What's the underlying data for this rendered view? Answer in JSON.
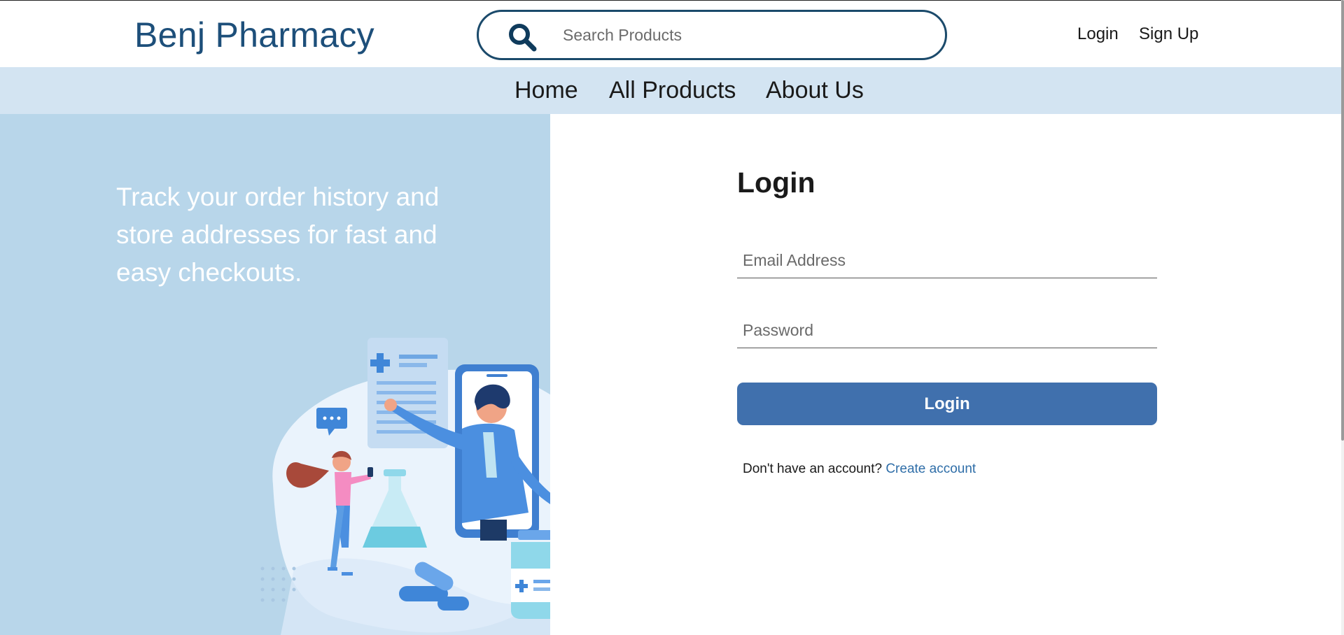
{
  "header": {
    "brand": "Benj Pharmacy",
    "search_placeholder": "Search Products",
    "login_link": "Login",
    "signup_link": "Sign Up"
  },
  "nav": {
    "items": [
      {
        "label": "Home"
      },
      {
        "label": "All Products"
      },
      {
        "label": "About Us"
      }
    ]
  },
  "promo": {
    "text": "Track your order history and store addresses for fast and easy checkouts."
  },
  "login_form": {
    "title": "Login",
    "email_placeholder": "Email Address",
    "password_placeholder": "Password",
    "submit_label": "Login",
    "no_account_text": "Don't have an account?",
    "create_account_link": "Create account"
  },
  "icons": {
    "search": "search-icon",
    "illustration": "pharmacy-illustration"
  },
  "colors": {
    "brand": "#1d4f7a",
    "nav_bg": "#d3e4f2",
    "left_panel_bg": "#b8d6ea",
    "button": "#4070ad",
    "link": "#2f6ea8"
  }
}
